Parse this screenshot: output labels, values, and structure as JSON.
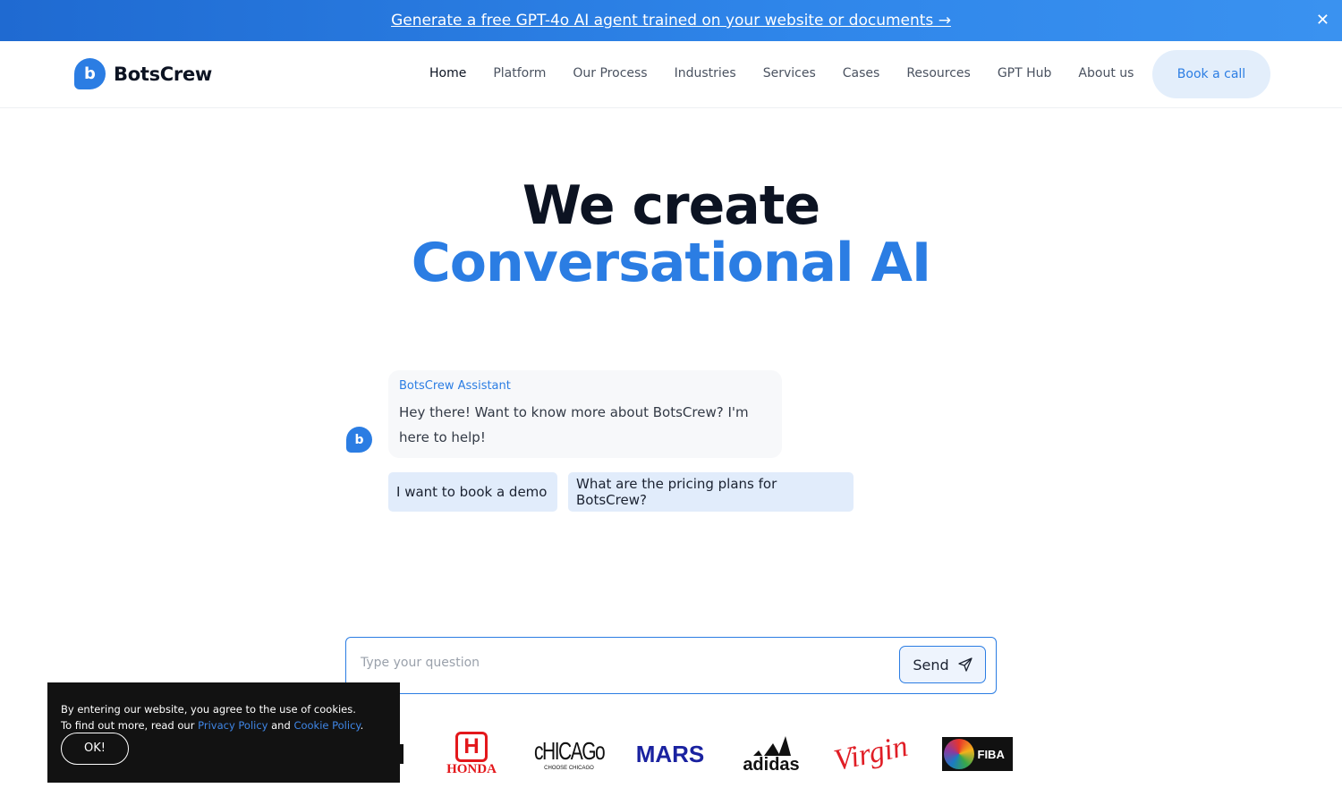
{
  "banner": {
    "text": "Generate a free GPT-4o AI agent trained on your website or documents →",
    "close_icon": "close-icon"
  },
  "nav": {
    "logo_text": "BotsCrew",
    "logo_mark": "b",
    "items": [
      {
        "label": "Home",
        "active": true
      },
      {
        "label": "Platform"
      },
      {
        "label": "Our Process"
      },
      {
        "label": "Industries"
      },
      {
        "label": "Services"
      },
      {
        "label": "Cases"
      },
      {
        "label": "Resources"
      },
      {
        "label": "GPT Hub"
      },
      {
        "label": "About us"
      }
    ],
    "cta": "Book a call"
  },
  "hero": {
    "line1": "We create",
    "line2": "Conversational AI"
  },
  "chat": {
    "avatar": "b",
    "sender": "BotsCrew Assistant",
    "message": "Hey there! Want to know more about BotsCrew? I'm here to help!",
    "suggestions": [
      "I want to book a demo",
      "What are the pricing plans for BotsCrew?"
    ],
    "input_placeholder": "Type your question",
    "send_label": "Send",
    "send_icon": "paper-plane-icon"
  },
  "clients": {
    "logos": [
      {
        "name": "HONDA"
      },
      {
        "name": "cHICAGo",
        "sub": "CHOOSE CHICAGO"
      },
      {
        "name": "MARS"
      },
      {
        "name": "adidas"
      },
      {
        "name": "Virgin"
      },
      {
        "name": "FIBA"
      }
    ]
  },
  "cookie": {
    "line1": "By entering our website, you agree to the use of cookies.",
    "line2_prefix": "To find out more, read our ",
    "privacy": "Privacy Policy",
    "and": " and ",
    "cookie_policy": "Cookie Policy",
    "end": ".",
    "ok": "OK!"
  },
  "colors": {
    "brand": "#2b7de3",
    "banner": "#1f6ad1",
    "cookie_bg": "#121212"
  }
}
